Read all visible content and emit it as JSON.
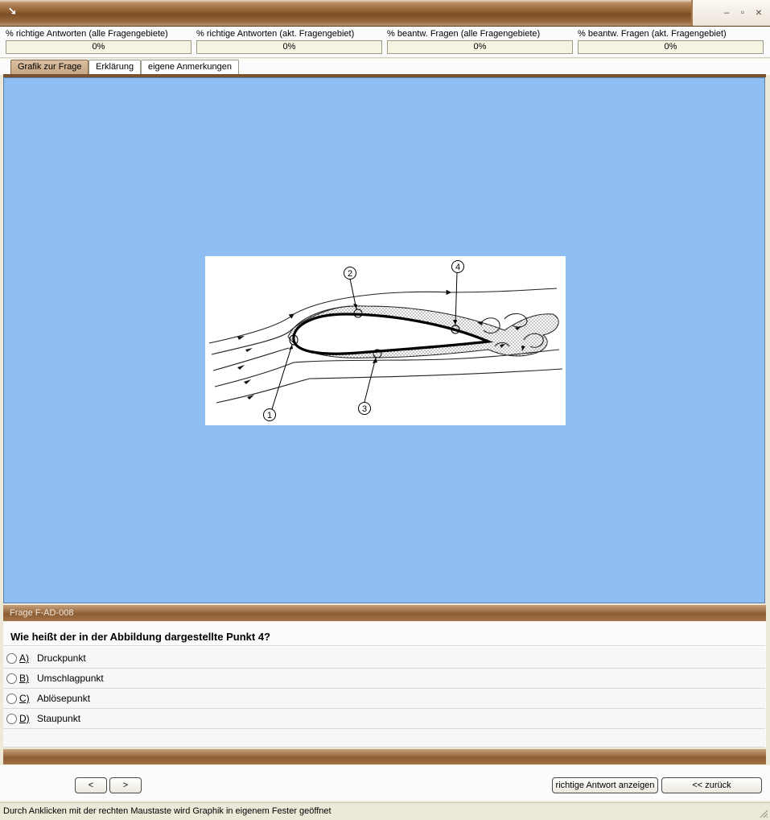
{
  "window": {
    "app_icon": "resize-arrow-icon",
    "controls": [
      "minimize-icon",
      "maximize-icon",
      "close-icon"
    ],
    "minimize_glyph": "–",
    "maximize_glyph": "▫",
    "close_glyph": "×"
  },
  "stats": [
    {
      "label": "% richtige Antworten (alle Fragengebiete)",
      "value": "0%"
    },
    {
      "label": "% richtige Antworten (akt. Fragengebiet)",
      "value": "0%"
    },
    {
      "label": "% beantw. Fragen (alle Fragengebiete)",
      "value": "0%"
    },
    {
      "label": "% beantw. Fragen (akt.  Fragengebiet)",
      "value": "0%"
    }
  ],
  "tabs": [
    {
      "label": "Grafik zur Frage",
      "active": true
    },
    {
      "label": "Erklärung",
      "active": false
    },
    {
      "label": "eigene Anmerkungen",
      "active": false
    }
  ],
  "figure": {
    "callouts": [
      "1",
      "2",
      "3",
      "4"
    ]
  },
  "question": {
    "id": "Frage F-AD-008",
    "text": "Wie heißt der in der Abbildung dargestellte Punkt 4?",
    "answers": [
      {
        "key": "A)",
        "text": "Druckpunkt"
      },
      {
        "key": "B)",
        "text": "Umschlagpunkt"
      },
      {
        "key": "C)",
        "text": "Ablösepunkt"
      },
      {
        "key": "D)",
        "text": "Staupunkt"
      }
    ]
  },
  "buttons": {
    "prev": "<",
    "next": ">",
    "show_answer": "richtige Antwort anzeigen",
    "back": "<< zurück"
  },
  "status": {
    "text": "Durch Anklicken mit der rechten Maustaste wird Graphik in eigenem Fester geöffnet"
  }
}
